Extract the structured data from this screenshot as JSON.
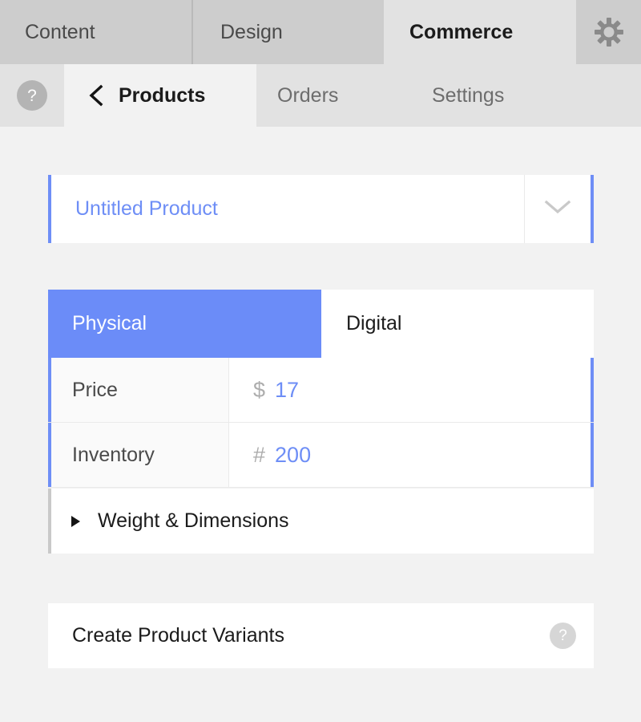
{
  "app_tabs": [
    {
      "label": "Content",
      "active": false
    },
    {
      "label": "Design",
      "active": false
    },
    {
      "label": "Commerce",
      "active": true
    }
  ],
  "settings_gear": {
    "icon": "gear-icon"
  },
  "section_nav": {
    "help": {
      "icon": "help-icon",
      "label": "?"
    },
    "tabs": [
      {
        "label": "Products",
        "active": true,
        "back_icon": "chevron-left-icon"
      },
      {
        "label": "Orders",
        "active": false
      },
      {
        "label": "Settings",
        "active": false
      }
    ]
  },
  "product": {
    "name_value": "Untitled Product",
    "name_placeholder": "Untitled Product",
    "dropdown_icon": "chevron-down-icon",
    "type_toggle": {
      "options": [
        {
          "label": "Physical",
          "selected": true
        },
        {
          "label": "Digital",
          "selected": false
        }
      ]
    },
    "fields": [
      {
        "label": "Price",
        "prefix": "$",
        "value": "17"
      },
      {
        "label": "Inventory",
        "prefix": "#",
        "value": "200"
      }
    ],
    "accordion": {
      "label": "Weight & Dimensions",
      "expanded": false,
      "toggle_icon": "triangle-right-icon"
    }
  },
  "variants": {
    "label": "Create Product Variants",
    "help": {
      "icon": "help-icon",
      "label": "?"
    }
  },
  "colors": {
    "accent_blue": "#6e8ef6",
    "toggle_blue": "#6b8cf8",
    "page_bg": "#f2f2f2",
    "topbar_bg": "#cdcdcd",
    "subbar_bg": "#e2e2e2"
  }
}
